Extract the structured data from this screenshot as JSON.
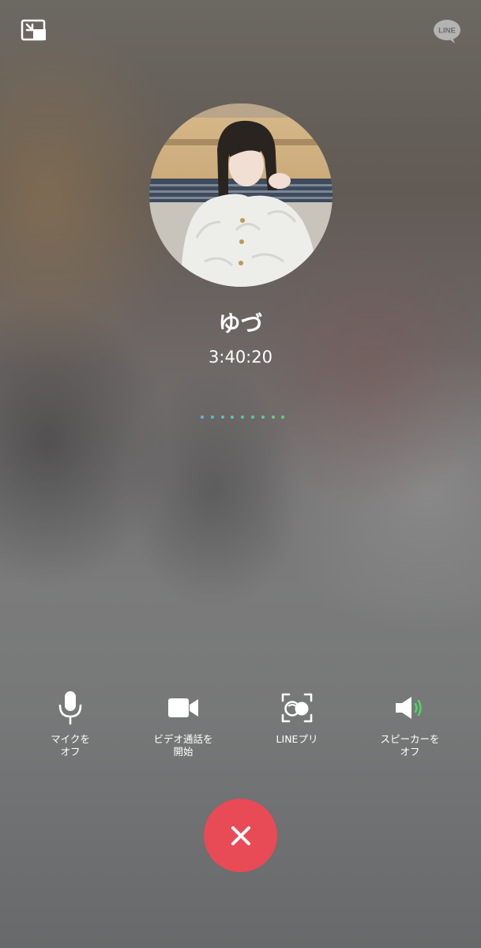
{
  "topbar": {
    "pip_icon": "exit-fullscreen-icon",
    "logo_text": "LINE"
  },
  "caller": {
    "name": "ゆづ",
    "duration": "3:40:20"
  },
  "signal": {
    "dot_count": 9,
    "colors": [
      "#5bb8d8",
      "#5cbacf",
      "#5dbdc4",
      "#5ec1b6",
      "#5fc4a8",
      "#60c79a",
      "#61ca8c",
      "#62cd7e",
      "#63d070"
    ]
  },
  "controls": [
    {
      "icon": "microphone-icon",
      "line1": "マイクを",
      "line2": "オフ"
    },
    {
      "icon": "video-camera-icon",
      "line1": "ビデオ通話を",
      "line2": "開始"
    },
    {
      "icon": "line-puri-icon",
      "line1": "LINEプリ",
      "line2": ""
    },
    {
      "icon": "speaker-icon",
      "line1": "スピーカーを",
      "line2": "オフ"
    }
  ],
  "end_call": {
    "icon": "close-icon"
  },
  "colors": {
    "end_call": "#e84a56",
    "speaker_wave": "#4cd964",
    "text": "#ffffff"
  }
}
